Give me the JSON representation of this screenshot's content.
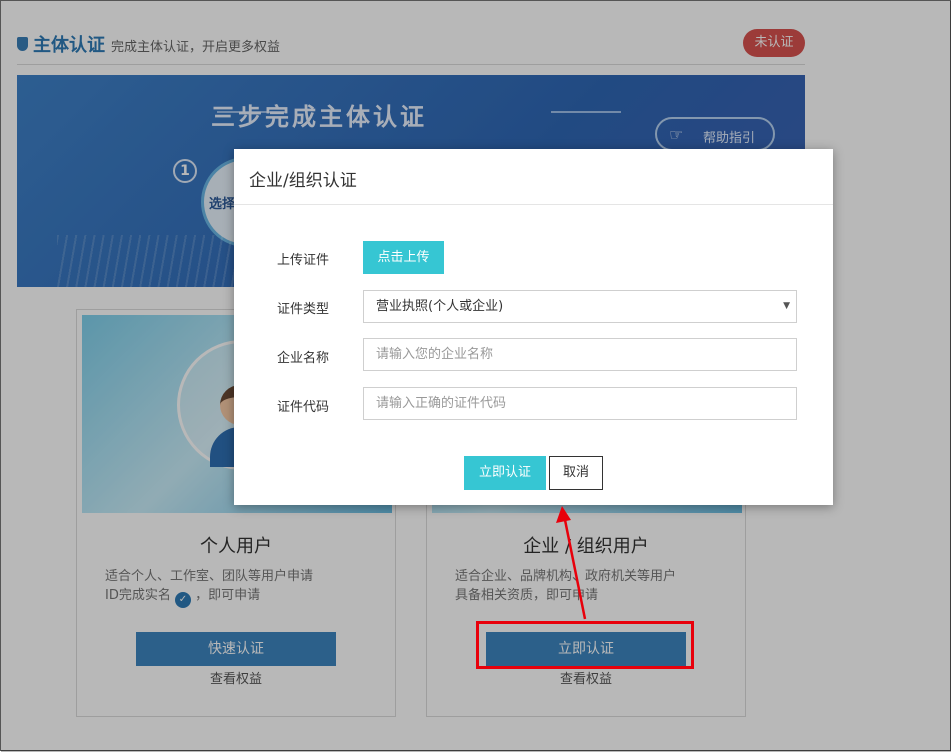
{
  "header": {
    "title": "主体认证",
    "subtitle": "完成主体认证，开启更多权益",
    "status_badge": "未认证"
  },
  "banner": {
    "title": "三步完成主体认证",
    "help_label": "帮助指引",
    "step_number": "1",
    "step_label": "选择"
  },
  "cards": [
    {
      "title": "个人用户",
      "desc_line1": "适合个人、工作室、团队等用户申请",
      "desc_line2_a": "ID完成实名",
      "desc_line2_b": "，即可申请",
      "button": "快速认证",
      "link": "查看权益"
    },
    {
      "title": "企业 / 组织用户",
      "desc_line1": "适合企业、品牌机构、政府机关等用户",
      "desc_line2": "具备相关资质，即可申请",
      "button": "立即认证",
      "link": "查看权益"
    }
  ],
  "modal": {
    "title": "企业/组织认证",
    "upload_label": "上传证件",
    "upload_button": "点击上传",
    "type_label": "证件类型",
    "type_value": "营业执照(个人或企业)",
    "name_label": "企业名称",
    "name_placeholder": "请输入您的企业名称",
    "code_label": "证件代码",
    "code_placeholder": "请输入正确的证件代码",
    "submit_button": "立即认证",
    "cancel_button": "取消"
  },
  "colors": {
    "accent": "#36c6d3",
    "brand_blue": "#2e7bb6",
    "badge_red": "#d9534f",
    "annotation_red": "#e8000b"
  },
  "icons": {
    "header": "shield-icon",
    "help": "hand-pointer-icon",
    "check": "check-circle-icon",
    "select": "caret-down-icon"
  }
}
